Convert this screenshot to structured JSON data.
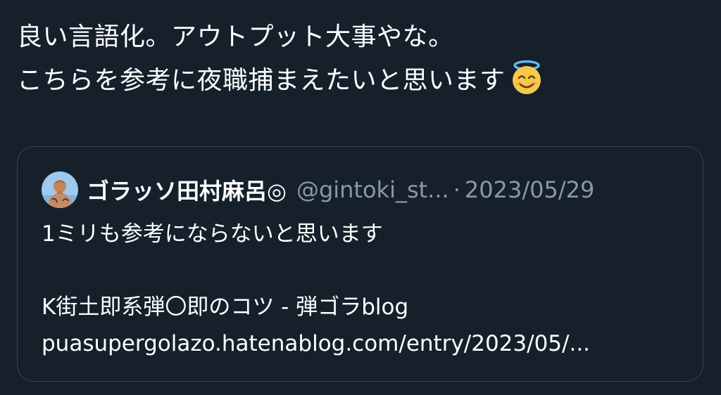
{
  "tweet": {
    "line1": "良い言語化。アウトプット大事やな。",
    "line2": "こちらを参考に夜職捕まえたいと思います",
    "emoji": "smiling-face-with-halo-icon"
  },
  "quote": {
    "display_name": "ゴラッソ田村麻呂◎",
    "handle": "@gintoki_st...",
    "separator": "·",
    "date": "2023/05/29",
    "text_line1": "1ミリも参考にならないと思います",
    "link_title": "K街土即系弾〇即のコツ - 弾ゴラblog",
    "link_url": "puasupergolazo.hatenablog.com/entry/2023/05/..."
  },
  "colors": {
    "background": "#15202b",
    "border": "#38444d",
    "secondary_text": "#8b98a5",
    "primary_text": "#ffffff"
  }
}
